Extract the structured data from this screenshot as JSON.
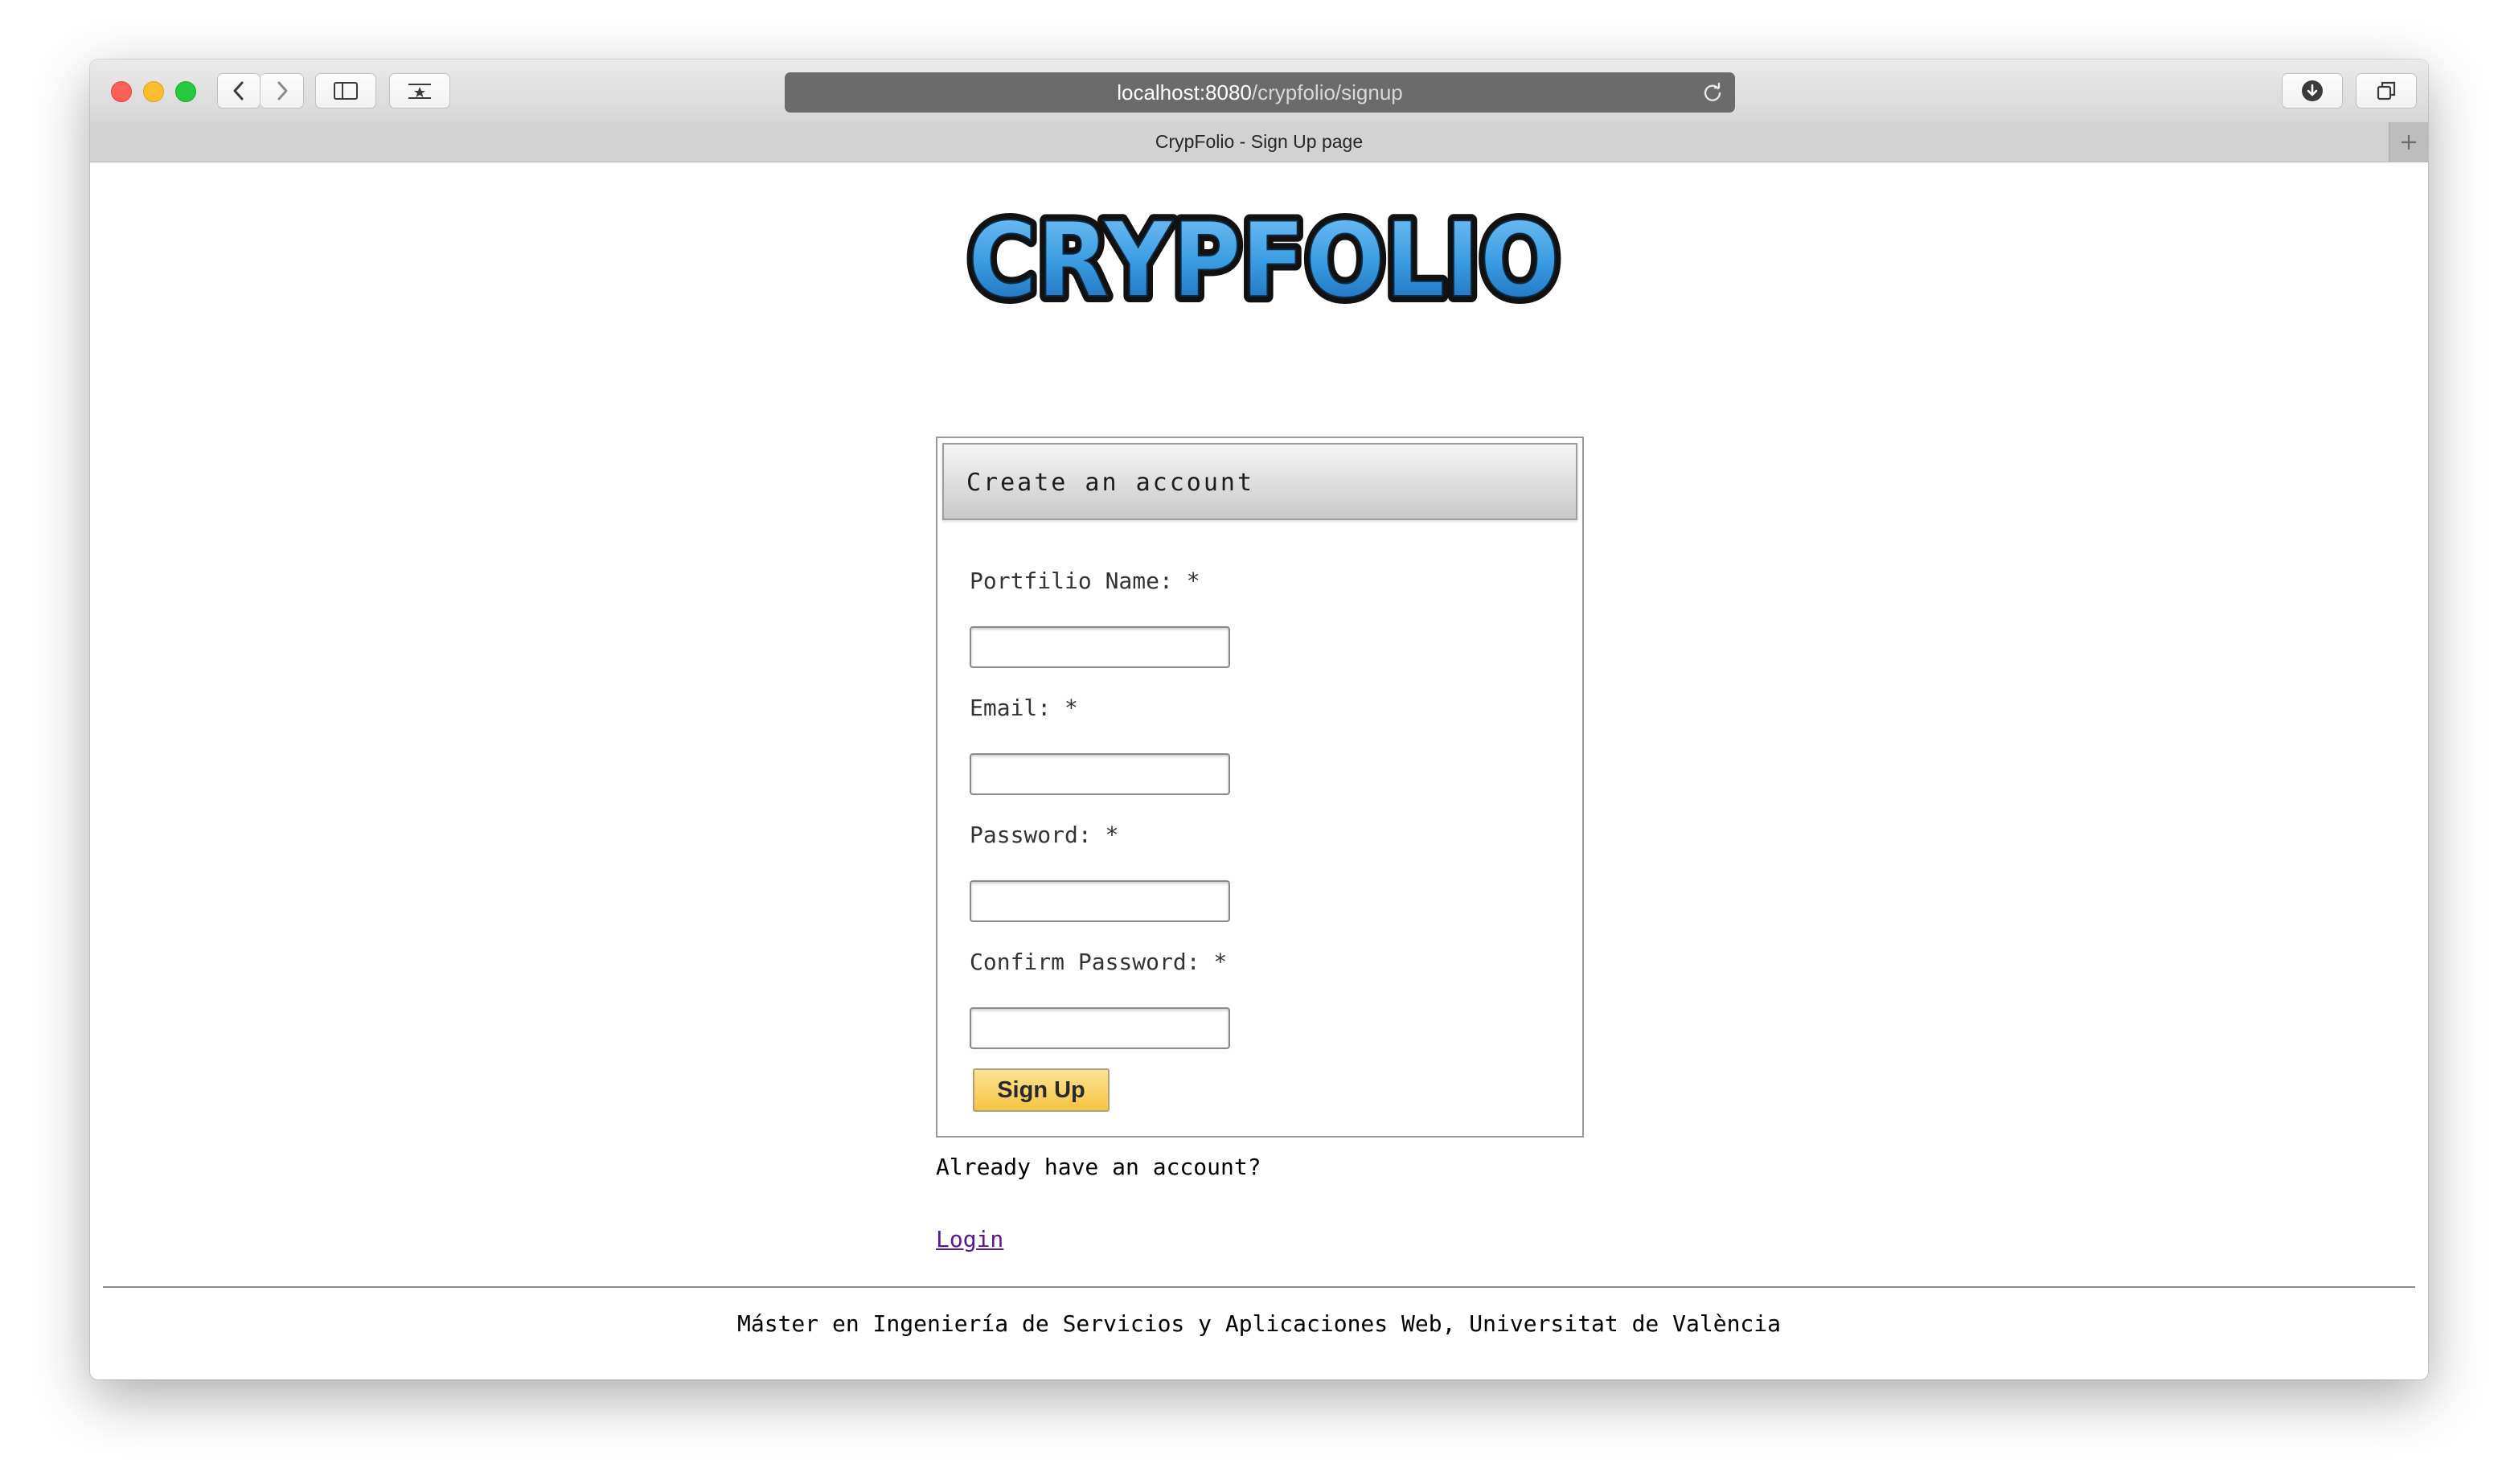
{
  "browser": {
    "url_host": "localhost:8080",
    "url_path": "/crypfolio/signup",
    "tab_title": "CrypFolio - Sign Up page"
  },
  "logo": {
    "text": "CRYPFOLIO"
  },
  "form": {
    "title": "Create an account",
    "fields": [
      {
        "label": "Portfilio Name: *",
        "value": ""
      },
      {
        "label": "Email: *",
        "value": ""
      },
      {
        "label": "Password: *",
        "value": ""
      },
      {
        "label": "Confirm Password: *",
        "value": ""
      }
    ],
    "submit_label": "Sign Up"
  },
  "login_prompt": "Already have an account?",
  "login_link": "Login",
  "footer": "Máster en Ingeniería de Servicios y Aplicaciones Web, Universitat de València",
  "colors": {
    "logo_fill": "#3b9de3",
    "button": "#fbd35a",
    "link_visited": "#551a8b"
  },
  "icons": [
    "back-icon",
    "forward-icon",
    "sidebar-icon",
    "bookmarks-icon",
    "reload-icon",
    "download-icon",
    "tabs-overview-icon",
    "plus-icon"
  ]
}
